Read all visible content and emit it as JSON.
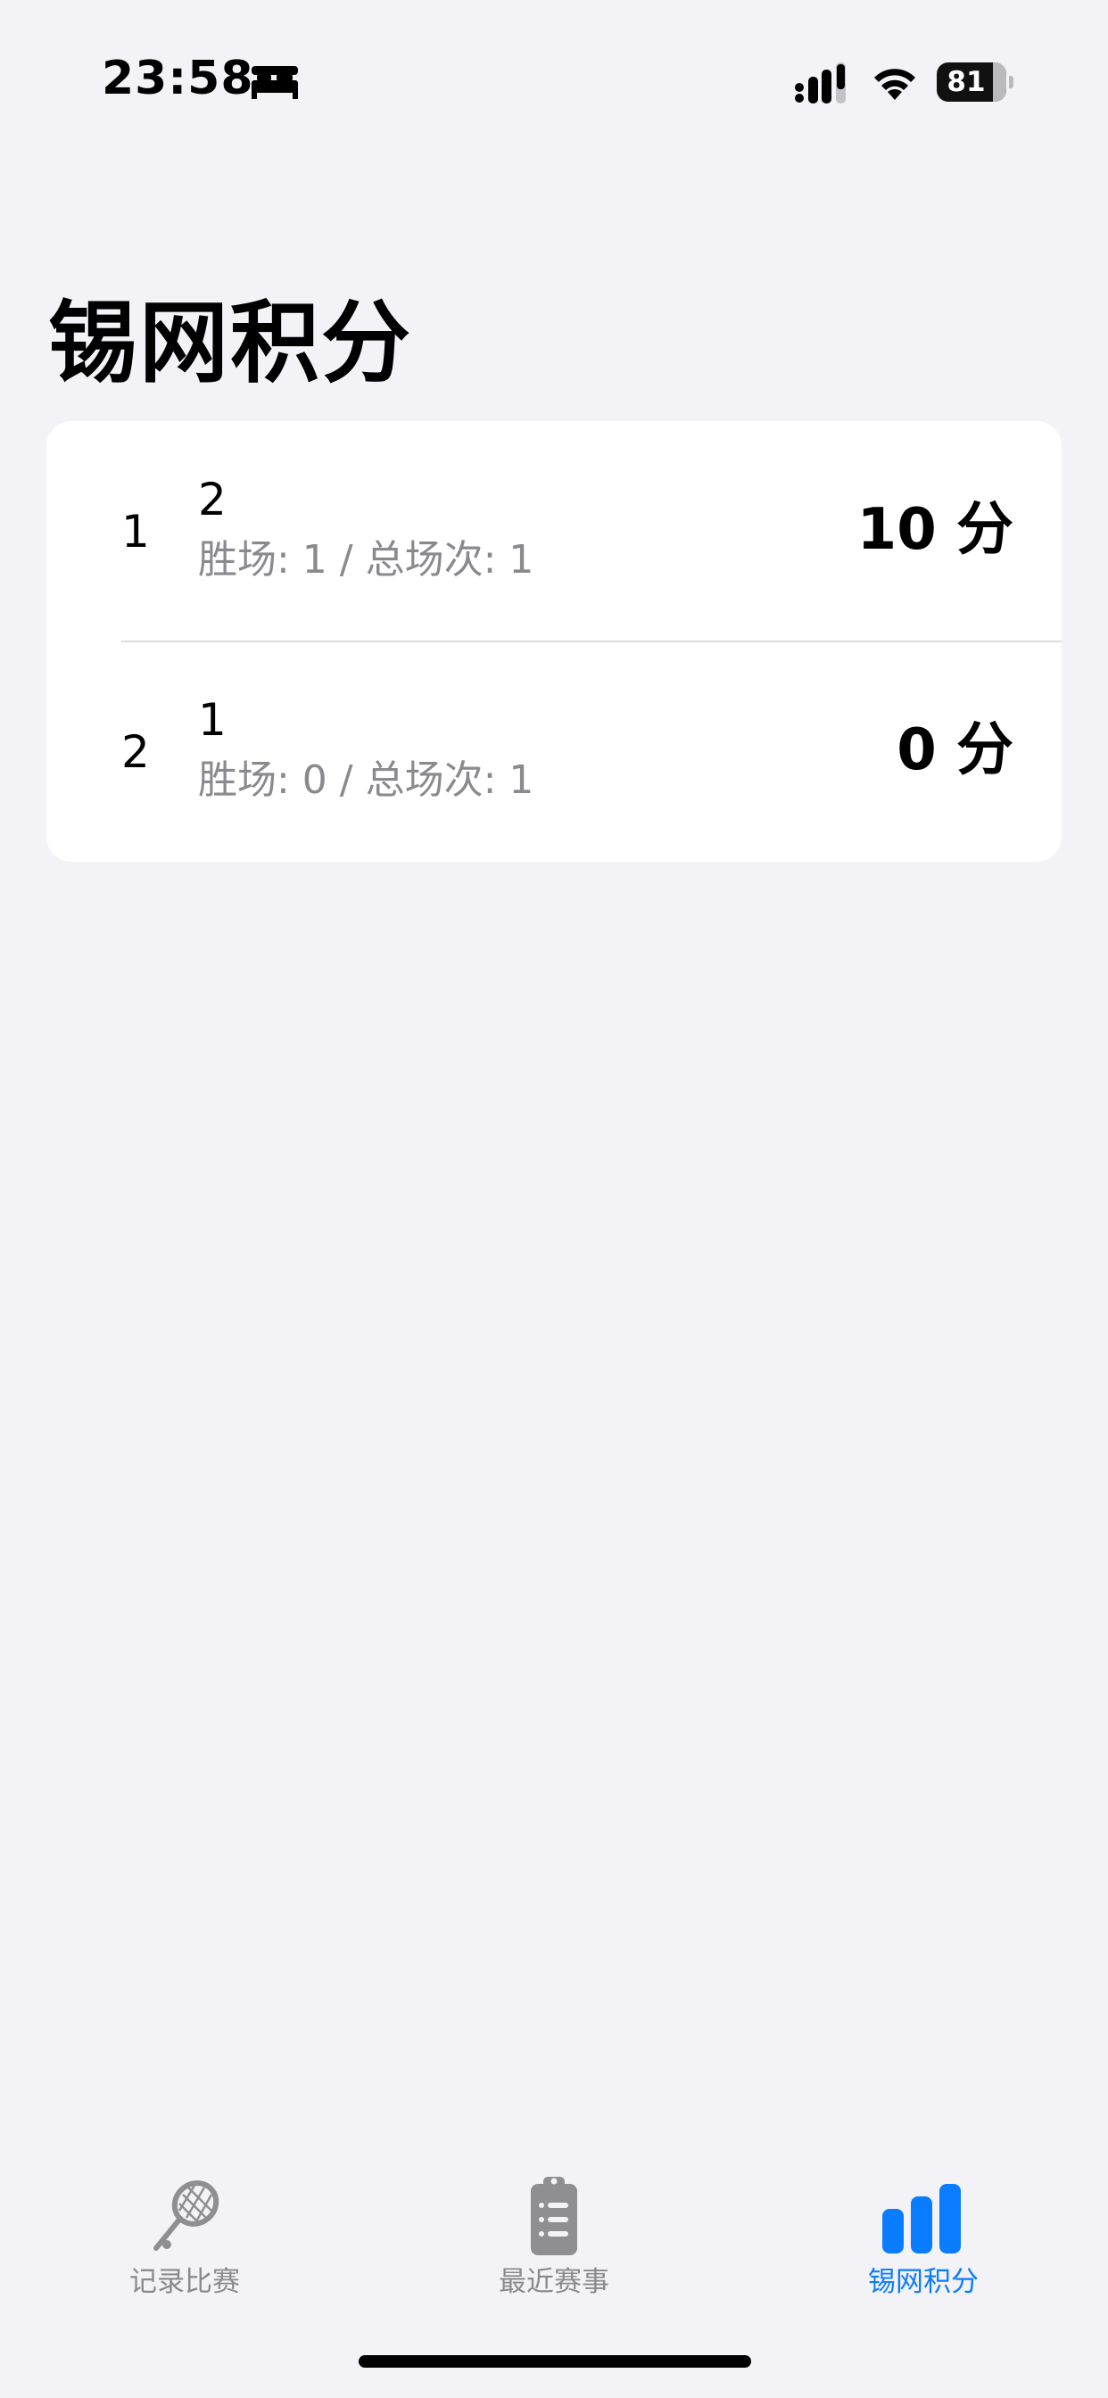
{
  "status_bar": {
    "time": "23:58",
    "battery_level": "81",
    "battery_fraction": 0.81
  },
  "title": "锡网积分",
  "rankings": [
    {
      "rank": "1",
      "name": "2",
      "stats": "胜场: 1 / 总场次: 1",
      "score": "10 分"
    },
    {
      "rank": "2",
      "name": "1",
      "stats": "胜场: 0 / 总场次: 1",
      "score": "0 分"
    }
  ],
  "tab_bar": {
    "tabs": [
      {
        "label": "记录比赛",
        "icon": "tennis-racket-icon",
        "active": false
      },
      {
        "label": "最近赛事",
        "icon": "clipboard-list-icon",
        "active": false
      },
      {
        "label": "锡网积分",
        "icon": "bar-chart-icon",
        "active": true
      }
    ]
  },
  "colors": {
    "background": "#f2f2f7",
    "card": "#ffffff",
    "accent": "#0a7cff",
    "secondary_text": "#8a8a8e"
  }
}
